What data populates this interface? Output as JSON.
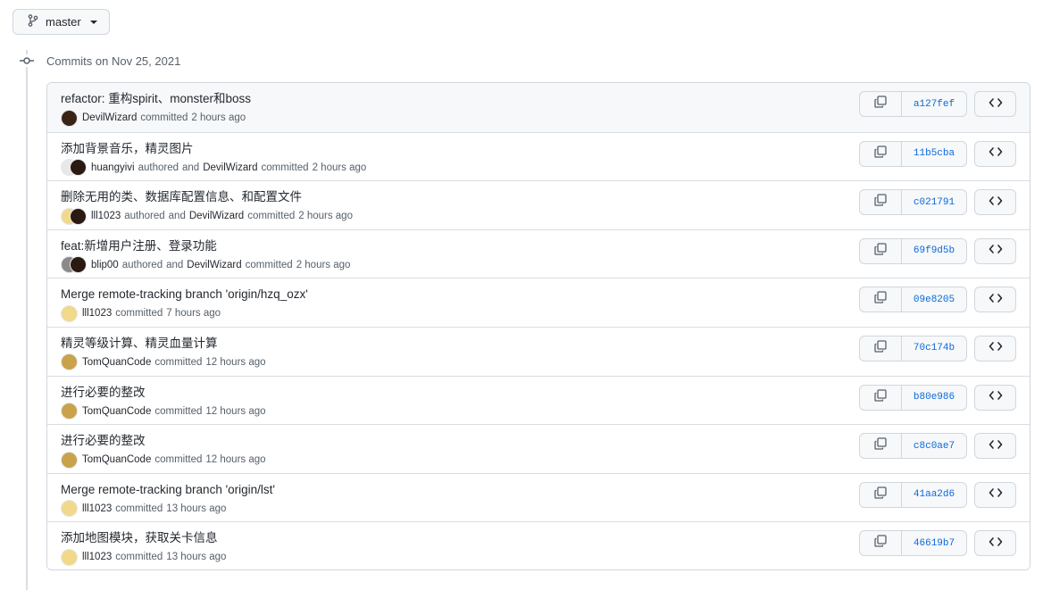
{
  "branch": {
    "name": "master"
  },
  "commits_heading": "Commits on Nov 25, 2021",
  "connector_and": "and",
  "commits": [
    {
      "title": "refactor: 重构spirit、monster和boss",
      "author": "DevilWizard",
      "co_author": "",
      "action": "committed",
      "time": "2 hours ago",
      "sha": "a127fef",
      "avatars": [
        "#3a2418"
      ]
    },
    {
      "title": "添加背景音乐，精灵图片",
      "author": "huangyivi",
      "co_author": "DevilWizard",
      "action": "authored",
      "time": "2 hours ago",
      "sha": "11b5cba",
      "avatars": [
        "#e8e8e8",
        "#2b1a12"
      ]
    },
    {
      "title": "删除无用的类、数据库配置信息、和配置文件",
      "author": "lll1023",
      "co_author": "DevilWizard",
      "action": "authored",
      "time": "2 hours ago",
      "sha": "c021791",
      "avatars": [
        "#f2d98a",
        "#2b1a12"
      ]
    },
    {
      "title": "feat:新增用户注册、登录功能",
      "author": "blip00",
      "co_author": "DevilWizard",
      "action": "authored",
      "time": "2 hours ago",
      "sha": "69f9d5b",
      "avatars": [
        "#8a8a8a",
        "#2b1a12"
      ]
    },
    {
      "title": "Merge remote-tracking branch 'origin/hzq_ozx'",
      "author": "lll1023",
      "co_author": "",
      "action": "committed",
      "time": "7 hours ago",
      "sha": "09e8205",
      "avatars": [
        "#f2d98a"
      ]
    },
    {
      "title": "精灵等级计算、精灵血量计算",
      "author": "TomQuanCode",
      "co_author": "",
      "action": "committed",
      "time": "12 hours ago",
      "sha": "70c174b",
      "avatars": [
        "#c9a24a"
      ]
    },
    {
      "title": "进行必要的整改",
      "author": "TomQuanCode",
      "co_author": "",
      "action": "committed",
      "time": "12 hours ago",
      "sha": "b80e986",
      "avatars": [
        "#c9a24a"
      ]
    },
    {
      "title": "进行必要的整改",
      "author": "TomQuanCode",
      "co_author": "",
      "action": "committed",
      "time": "12 hours ago",
      "sha": "c8c0ae7",
      "avatars": [
        "#c9a24a"
      ]
    },
    {
      "title": "Merge remote-tracking branch 'origin/lst'",
      "author": "lll1023",
      "co_author": "",
      "action": "committed",
      "time": "13 hours ago",
      "sha": "41aa2d6",
      "avatars": [
        "#f2d98a"
      ]
    },
    {
      "title": "添加地图模块，获取关卡信息",
      "author": "lll1023",
      "co_author": "",
      "action": "committed",
      "time": "13 hours ago",
      "sha": "46619b7",
      "avatars": [
        "#f2d98a"
      ]
    }
  ],
  "icons": {
    "branch": "git-branch-icon",
    "copy": "copy-icon",
    "browse": "code-icon",
    "timeline": "git-commit-icon"
  },
  "colors": {
    "link": "#0969da",
    "border": "#d0d7de",
    "muted": "#57606a"
  }
}
